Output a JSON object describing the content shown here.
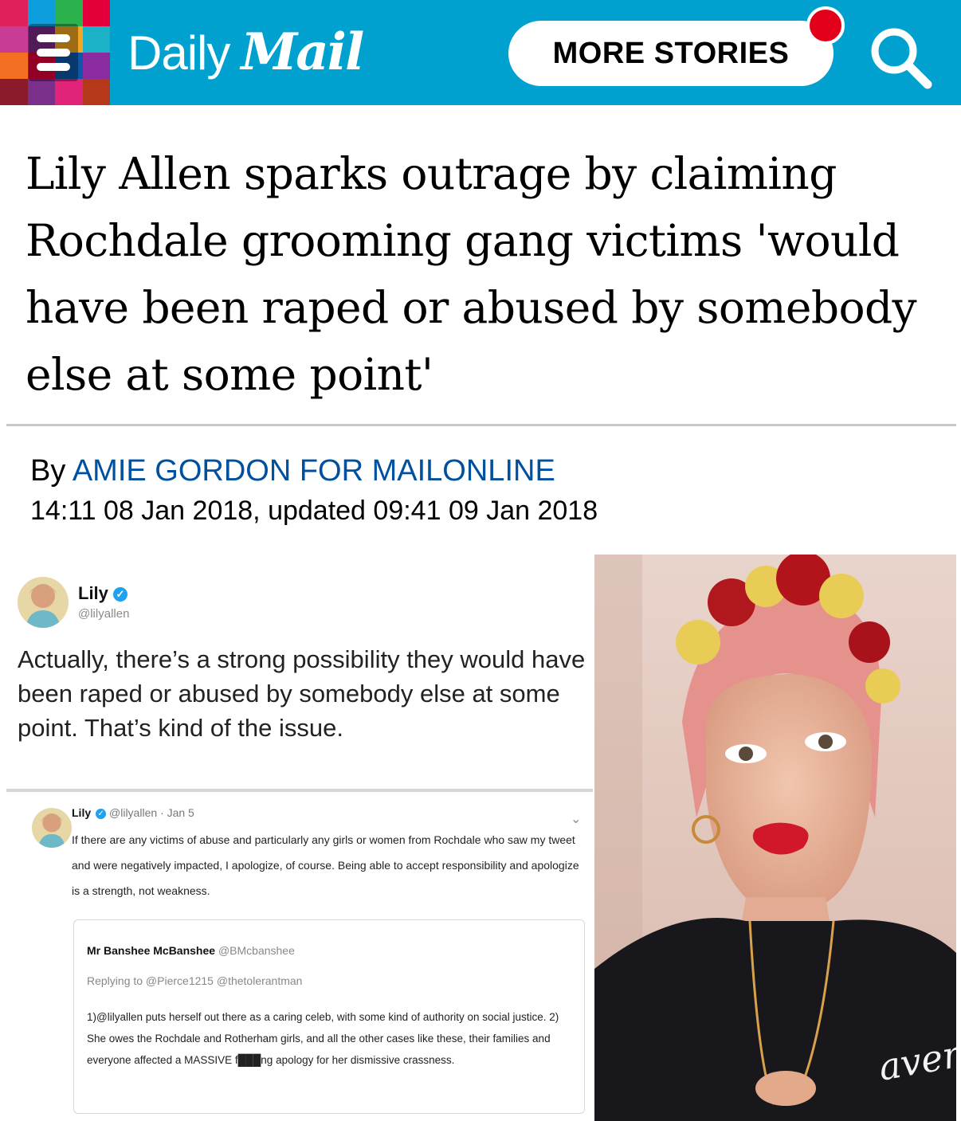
{
  "header": {
    "brand_daily": "Daily",
    "brand_mail": "Mail",
    "more_stories_label": "MORE STORIES",
    "colors": {
      "bar": "#00a0cf",
      "notification": "#e3001b"
    }
  },
  "article": {
    "headline": "Lily Allen sparks outrage by claiming Rochdale grooming gang victims 'would have been raped or abused by somebody else at some point'",
    "byline_prefix": "By",
    "author": "AMIE GORDON FOR MAILONLINE",
    "dateline": "14:11 08 Jan 2018, updated 09:41 09 Jan 2018"
  },
  "tweet_main": {
    "name": "Lily",
    "handle": "@lilyallen",
    "text": "Actually, there’s a strong possibility they would have been raped or abused by somebody else at some point. That’s kind of the issue."
  },
  "tweet_second": {
    "name": "Lily",
    "handle_date": "@lilyallen · Jan 5",
    "text": "If there are any victims of abuse and particularly any girls or women from Rochdale who saw my tweet and were negatively impacted, I apologize, of course. Being able to accept responsibility and apologize is a strength, not weakness."
  },
  "quoted_tweet": {
    "name": "Mr Banshee McBanshee",
    "handle": "@BMcbanshee",
    "replying": "Replying to @Pierce1215 @thetolerantman",
    "text": "1)@lilyallen puts herself out there as a caring celeb, with some kind of authority on social justice. 2) She owes the Rochdale and Rotherham girls, and all the other cases like these, their families and everyone affected a MASSIVE f███ng apology for her dismissive crassness."
  },
  "photo": {
    "shirt_text": "avem"
  }
}
